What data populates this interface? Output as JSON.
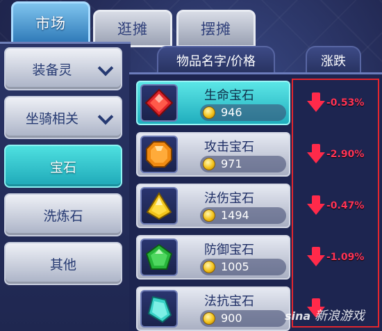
{
  "tabs": [
    {
      "label": "市场",
      "active": true
    },
    {
      "label": "逛摊",
      "active": false
    },
    {
      "label": "摆摊",
      "active": false
    }
  ],
  "sidebar": {
    "items": [
      {
        "label": "装备灵",
        "has_arrow": true,
        "active": false
      },
      {
        "label": "坐骑相关",
        "has_arrow": true,
        "active": false
      },
      {
        "label": "宝石",
        "has_arrow": false,
        "active": true
      },
      {
        "label": "洗炼石",
        "has_arrow": false,
        "active": false
      },
      {
        "label": "其他",
        "has_arrow": false,
        "active": false
      }
    ]
  },
  "headers": {
    "name_price": "物品名字/价格",
    "change": "涨跌"
  },
  "items": [
    {
      "name": "生命宝石",
      "price": "946",
      "change": "-0.53%",
      "gem": "red-gem-icon",
      "color": "#e0252b",
      "selected": true
    },
    {
      "name": "攻击宝石",
      "price": "971",
      "change": "-2.90%",
      "gem": "orange-gem-icon",
      "color": "#f08a12",
      "selected": false
    },
    {
      "name": "法伤宝石",
      "price": "1494",
      "change": "-0.47%",
      "gem": "yellow-gem-icon",
      "color": "#f2c41a",
      "selected": false
    },
    {
      "name": "防御宝石",
      "price": "1005",
      "change": "-1.09%",
      "gem": "green-gem-icon",
      "color": "#27b53a",
      "selected": false
    },
    {
      "name": "法抗宝石",
      "price": "900",
      "change": "",
      "gem": "cyan-gem-icon",
      "color": "#39d3c8",
      "selected": false
    }
  ],
  "watermark": {
    "en": "sina",
    "cn": "新浪游戏"
  },
  "colors": {
    "accent_cyan": "#2cc5d0",
    "down_red": "#ff2a4a",
    "highlight_box": "#e3262e"
  }
}
